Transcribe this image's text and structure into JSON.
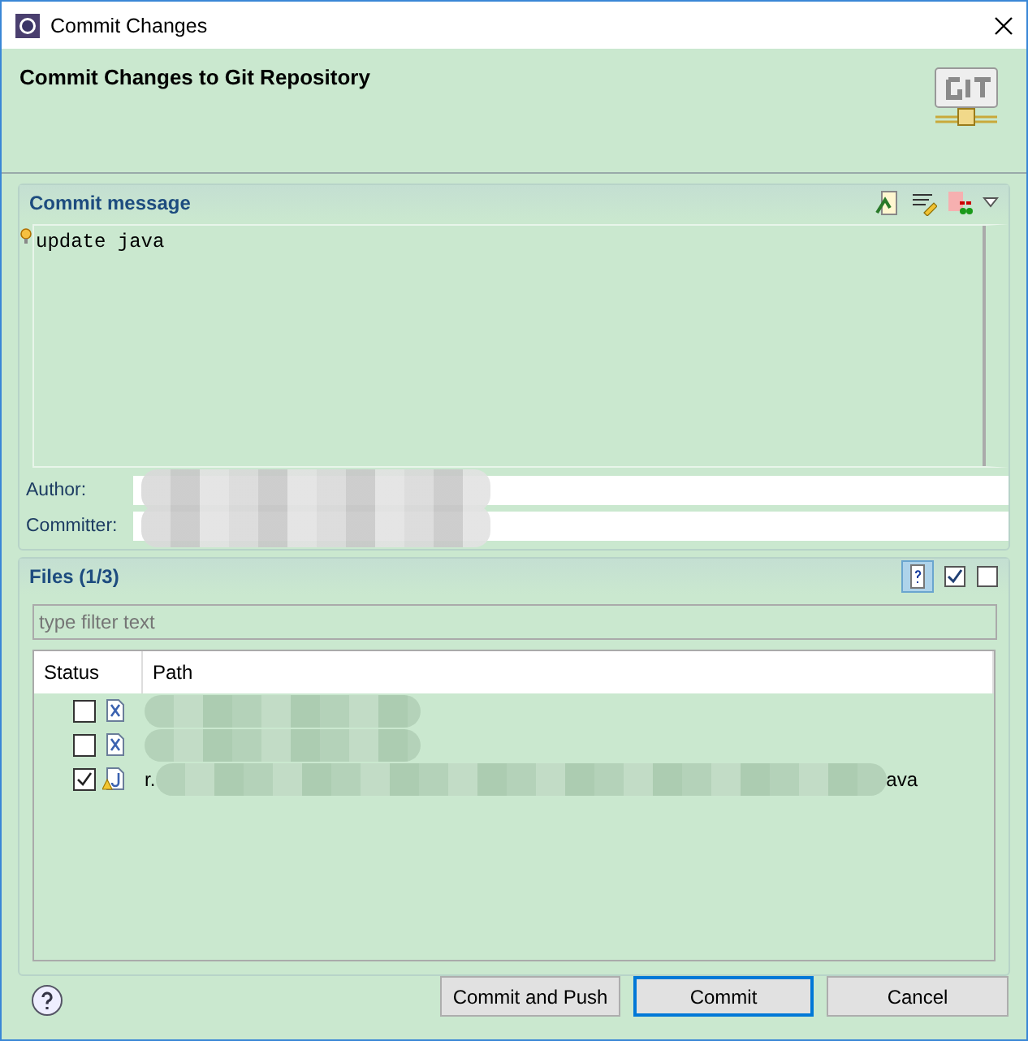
{
  "window": {
    "title": "Commit Changes"
  },
  "banner": {
    "title": "Commit Changes to Git Repository"
  },
  "commit_message": {
    "heading": "Commit message",
    "text": "update java"
  },
  "author": {
    "label": "Author:"
  },
  "committer": {
    "label": "Committer:"
  },
  "files": {
    "heading": "Files (1/3)",
    "filter": {
      "placeholder": "type filter text"
    },
    "columns": [
      "Status",
      "Path"
    ],
    "rows": [
      {
        "kind": "xml",
        "checked": false,
        "warning": false,
        "path_start": "",
        "path_end": ""
      },
      {
        "kind": "xml",
        "checked": false,
        "warning": false,
        "path_start": "",
        "path_end": ""
      },
      {
        "kind": "java",
        "checked": true,
        "warning": true,
        "path_start": "r.",
        "path_end": "ava"
      }
    ]
  },
  "buttons": [
    {
      "label": "Commit and Push",
      "default": false
    },
    {
      "label": "Commit",
      "default": true
    },
    {
      "label": "Cancel",
      "default": false
    }
  ]
}
